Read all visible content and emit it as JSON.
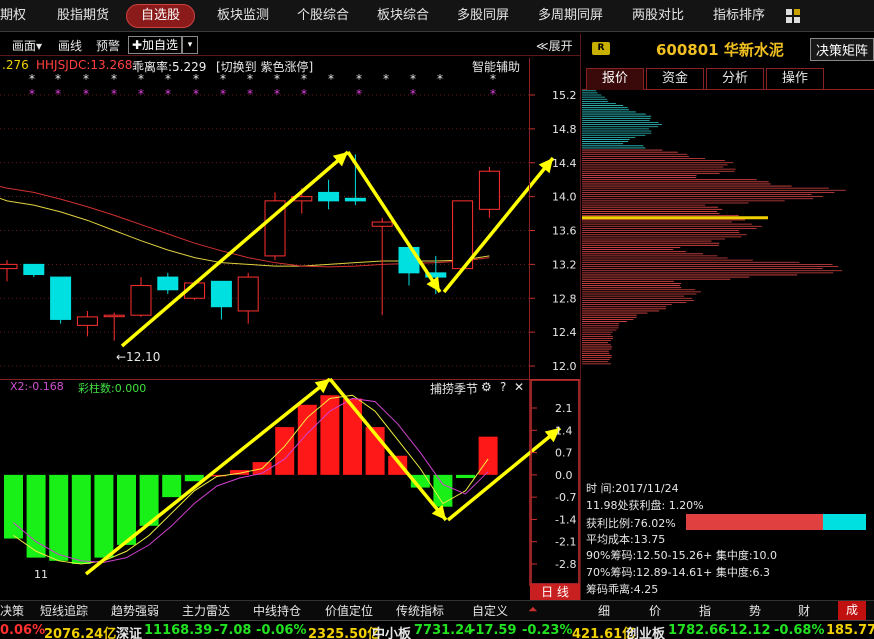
{
  "nav": {
    "items": [
      "期权",
      "股指期货",
      "自选股",
      "板块监测",
      "个股综合",
      "板块综合",
      "多股同屏",
      "多周期同屏",
      "两股对比",
      "指标排序"
    ],
    "active_index": 2
  },
  "chart_toolbar": {
    "draw": "画面▾",
    "line": "画线",
    "alert": "预警",
    "add_watch": "✚加自选",
    "dropdown": "▾",
    "expand": "≪展开"
  },
  "indicators": {
    "v1": ".276",
    "hhjsjdc": "HHJSJDC:13.268",
    "deviation": "乖离率:5.229",
    "switch_hint": "[切换到 紫色涨停]",
    "smart_assist": "智能辅助"
  },
  "main_chart": {
    "price_axis": [
      "15.2",
      "14.8",
      "14.4",
      "14.0",
      "13.6",
      "13.2",
      "12.8",
      "12.4",
      "12.0"
    ],
    "low_marker": "←12.10",
    "candles": [
      {
        "o": 13.15,
        "c": 13.2,
        "h": 13.25,
        "l": 13.0
      },
      {
        "o": 13.2,
        "c": 13.08,
        "h": 13.2,
        "l": 13.05
      },
      {
        "o": 13.05,
        "c": 12.55,
        "h": 13.05,
        "l": 12.5
      },
      {
        "o": 12.48,
        "c": 12.58,
        "h": 12.65,
        "l": 12.35
      },
      {
        "o": 12.6,
        "c": 12.6,
        "h": 12.63,
        "l": 12.3
      },
      {
        "o": 12.6,
        "c": 12.95,
        "h": 13.05,
        "l": 12.58
      },
      {
        "o": 13.05,
        "c": 12.9,
        "h": 13.1,
        "l": 12.85
      },
      {
        "o": 12.8,
        "c": 12.98,
        "h": 13.0,
        "l": 12.78
      },
      {
        "o": 13.0,
        "c": 12.7,
        "h": 13.0,
        "l": 12.55
      },
      {
        "o": 12.65,
        "c": 13.05,
        "h": 13.1,
        "l": 12.5
      },
      {
        "o": 13.3,
        "c": 13.95,
        "h": 14.05,
        "l": 13.25
      },
      {
        "o": 13.95,
        "c": 14.0,
        "h": 14.1,
        "l": 13.8
      },
      {
        "o": 14.05,
        "c": 13.95,
        "h": 14.2,
        "l": 13.85
      },
      {
        "o": 13.98,
        "c": 13.95,
        "h": 14.5,
        "l": 13.9
      },
      {
        "o": 13.65,
        "c": 13.7,
        "h": 13.75,
        "l": 12.6
      },
      {
        "o": 13.4,
        "c": 13.1,
        "h": 13.4,
        "l": 12.95
      },
      {
        "o": 13.1,
        "c": 13.05,
        "h": 13.3,
        "l": 12.85
      },
      {
        "o": 13.15,
        "c": 13.95,
        "h": 13.95,
        "l": 13.15
      },
      {
        "o": 13.85,
        "c": 14.3,
        "h": 14.35,
        "l": 13.75
      }
    ]
  },
  "sub_chart": {
    "x2": "X2:-0.168",
    "columns_label": "彩柱数:0.000",
    "capture": "捕捞季节",
    "axis": [
      "2.1",
      "1.4",
      "0.7",
      "0.0",
      "-0.7",
      "-1.4",
      "-2.1",
      "-2.8"
    ],
    "bottom_num": "11",
    "bars": [
      -2.0,
      -2.6,
      -2.7,
      -2.8,
      -2.6,
      -2.2,
      -1.6,
      -0.7,
      -0.2,
      0.0,
      0.15,
      0.4,
      1.5,
      2.2,
      2.5,
      2.4,
      1.5,
      0.6,
      -0.4,
      -1.0,
      -0.1,
      1.2
    ],
    "day_tab": "日 线"
  },
  "right_panel": {
    "badge": "R",
    "title": "600801 华新水泥",
    "decision_btn": "决策矩阵",
    "tabs": [
      "报价",
      "资金",
      "分析",
      "操作"
    ],
    "active_tab": 0,
    "info": {
      "time": "时      间:2017/11/24",
      "profit_at": "11.98处获利盘: 1.20%",
      "profit_ratio": "获利比例:76.02%",
      "avg_cost": "平均成本:13.75",
      "chip90": "90%筹码:12.50-15.26+ 集中度:10.0",
      "chip70": "70%筹码:12.89-14.61+ 集中度:6.3",
      "chip_dev": "筹码乖离:4.25"
    },
    "profit_ratio_value": 0.7602
  },
  "bottom_tabs": {
    "left": [
      "决策",
      "短线追踪",
      "趋势强弱",
      "主力雷达",
      "中线持仓",
      "价值定位",
      "传统指标",
      "自定义"
    ],
    "right": [
      "细",
      "价",
      "指",
      "势",
      "财",
      "成"
    ]
  },
  "ticker": {
    "t1": "0.06%",
    "t2": "2076.24亿",
    "t3": "深证",
    "t4": "11168.39",
    "t5": "-7.08",
    "t6": "-0.06%",
    "t7": "2325.50亿",
    "t8": "中小板",
    "t9": "7731.24",
    "t10": "-17.59",
    "t11": "-0.23%",
    "t12": "421.61亿",
    "t13": "创业板",
    "t14": "1782.66",
    "t15": "-12.12",
    "t16": "-0.68%",
    "t17": "185.77"
  },
  "colors": {
    "up": "#ff3030",
    "down": "#00e0e0",
    "arrow": "#ffff00",
    "grid_red": "#8a2020"
  }
}
